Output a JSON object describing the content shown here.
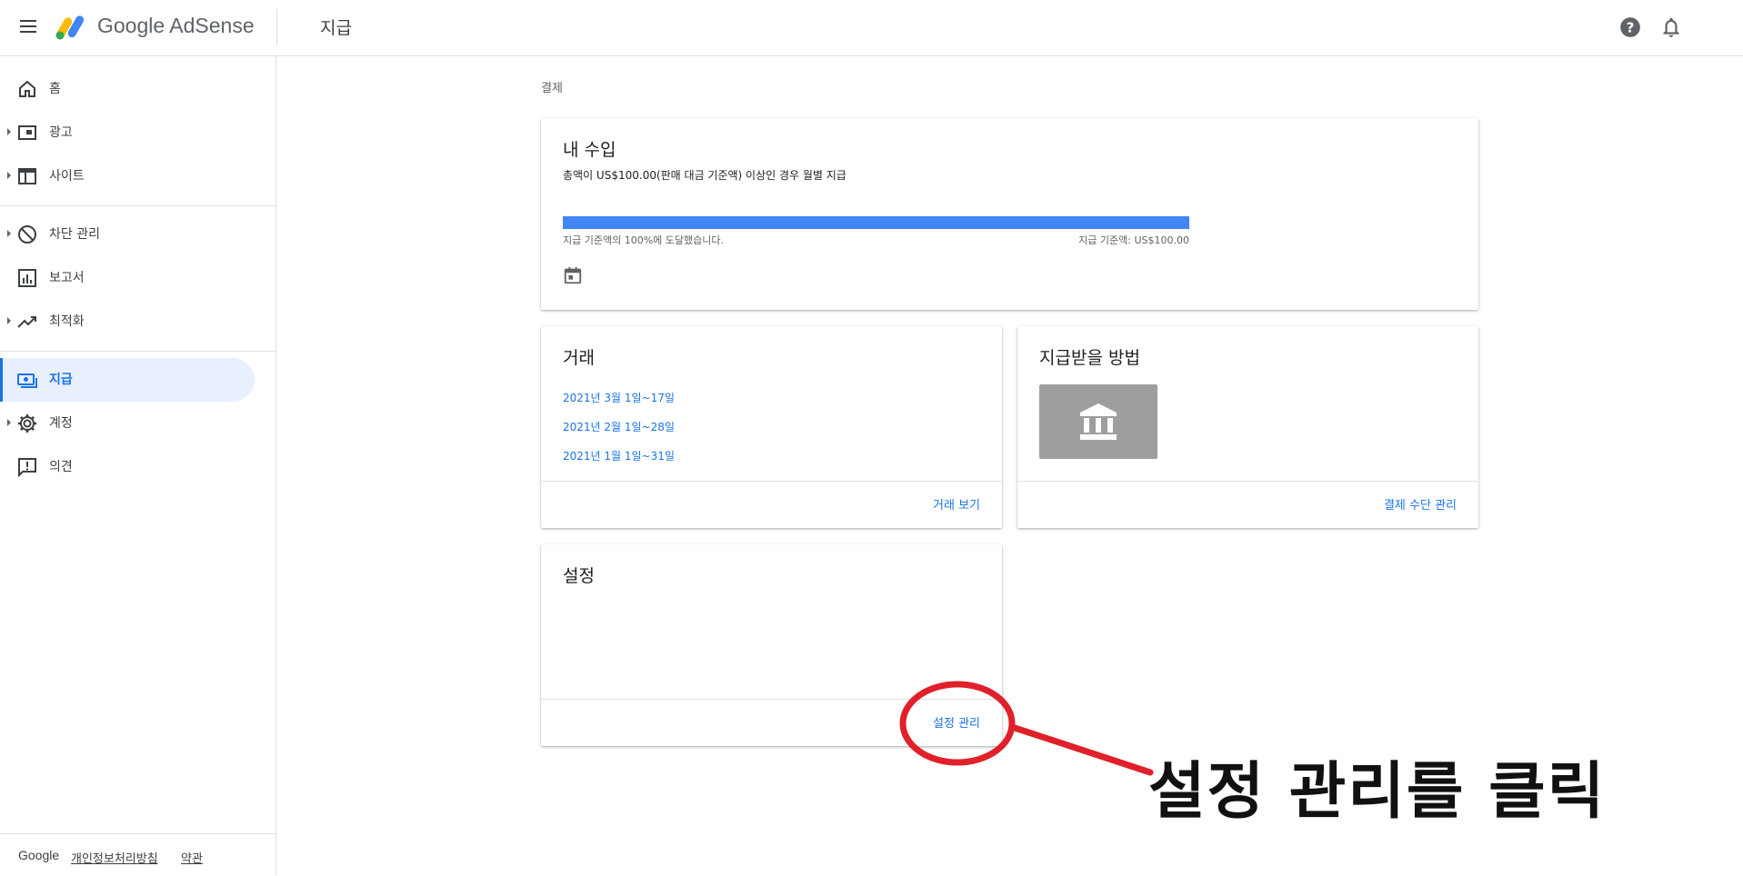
{
  "header": {
    "brand": "Google AdSense",
    "title": "지급"
  },
  "sidebar": {
    "items": [
      {
        "label": "홈",
        "icon": "home-icon"
      },
      {
        "label": "광고",
        "icon": "ads-icon"
      },
      {
        "label": "사이트",
        "icon": "sites-icon"
      },
      {
        "label": "차단 관리",
        "icon": "block-icon"
      },
      {
        "label": "보고서",
        "icon": "reports-icon"
      },
      {
        "label": "최적화",
        "icon": "trending-up-icon"
      },
      {
        "label": "지급",
        "icon": "payments-icon",
        "active": true
      },
      {
        "label": "계정",
        "icon": "gear-icon"
      },
      {
        "label": "의견",
        "icon": "feedback-icon"
      }
    ],
    "footer": {
      "google": "Google",
      "privacy": "개인정보처리방침",
      "terms": "약관"
    }
  },
  "main": {
    "breadcrumb": "결제",
    "earnings": {
      "title": "내 수입",
      "subtitle": "총액이 US$100.00(판매 대금 기준액) 이상인 경우 월별 지급",
      "progress_percent": 100,
      "progress_label": "지급 기준액의 100%에 도달했습니다.",
      "threshold_label": "지급 기준액: US$100.00"
    },
    "transactions": {
      "title": "거래",
      "items": [
        "2021년 3월 1일~17일",
        "2021년 2월 1일~28일",
        "2021년 1월 1일~31일"
      ],
      "link": "거래 보기"
    },
    "payment_method": {
      "title": "지급받을 방법",
      "link": "결제 수단 관리",
      "tile_icon": "bank-icon"
    },
    "settings": {
      "title": "설정",
      "link": "설정 관리"
    }
  },
  "annotation": {
    "text": "설정 관리를 클릭",
    "color": "#e0202a"
  },
  "colors": {
    "accent": "#1a73e8",
    "progress": "#4285f4",
    "active_bg": "#e8f0fe"
  }
}
